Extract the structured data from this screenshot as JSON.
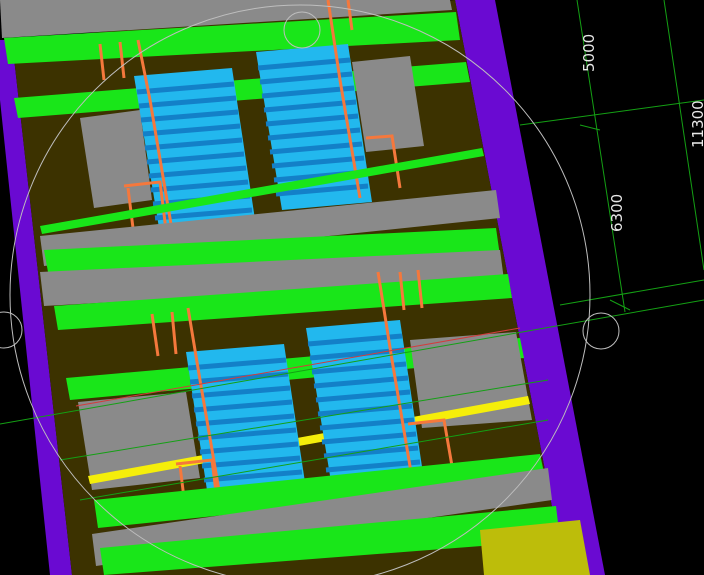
{
  "dimensions": {
    "upper": "5000",
    "lower": "6300",
    "total": "11300"
  },
  "colors": {
    "background": "#000000",
    "slab_green": "#19e619",
    "slab_dark_green": "#0aa60a",
    "stair_blue": "#22b8ee",
    "stair_stripe": "#1380c8",
    "wall_grey": "#8a8a8a",
    "floor_olive": "#3c3200",
    "boundary_purple": "#6a0ad2",
    "handrail_orange": "#f5783c",
    "accent_yellow": "#f5ee0a",
    "ground_yellow": "#bdbd0a",
    "dim_line_green": "#14a014",
    "circle_white": "#bebebe"
  }
}
